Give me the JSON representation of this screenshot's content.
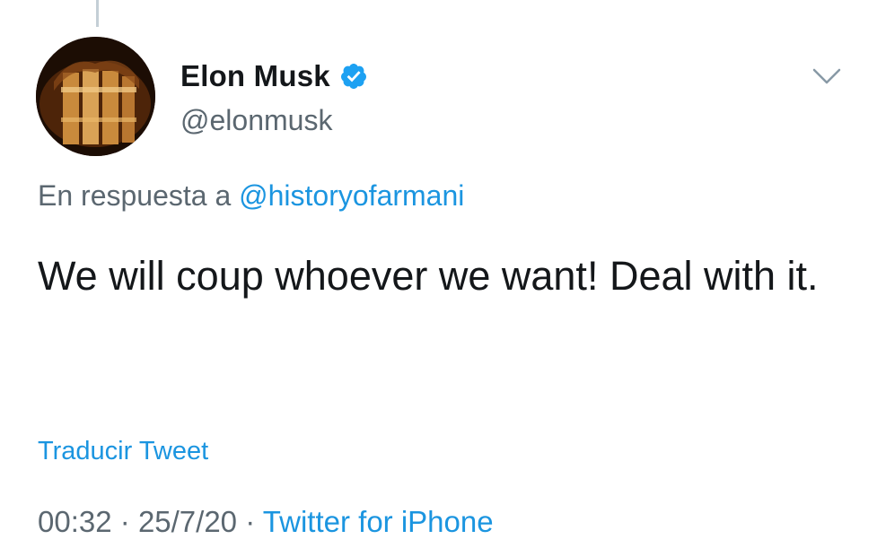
{
  "tweet": {
    "author": {
      "name": "Elon Musk",
      "handle": "@elonmusk",
      "verified": true,
      "avatar_icon": "avatar-image"
    },
    "reply": {
      "prefix": "En respuesta a",
      "mention": "@historyofarmani"
    },
    "text": "We will coup whoever we want! Deal with it.",
    "translate_label": "Traducir Tweet",
    "meta": {
      "time": "00:32",
      "sep1": "·",
      "date": "25/7/20",
      "sep2": "·",
      "source": "Twitter for iPhone"
    },
    "colors": {
      "link": "#1b95e0",
      "secondary_text": "#5b6770",
      "verified_badge": "#1da1f2"
    }
  }
}
